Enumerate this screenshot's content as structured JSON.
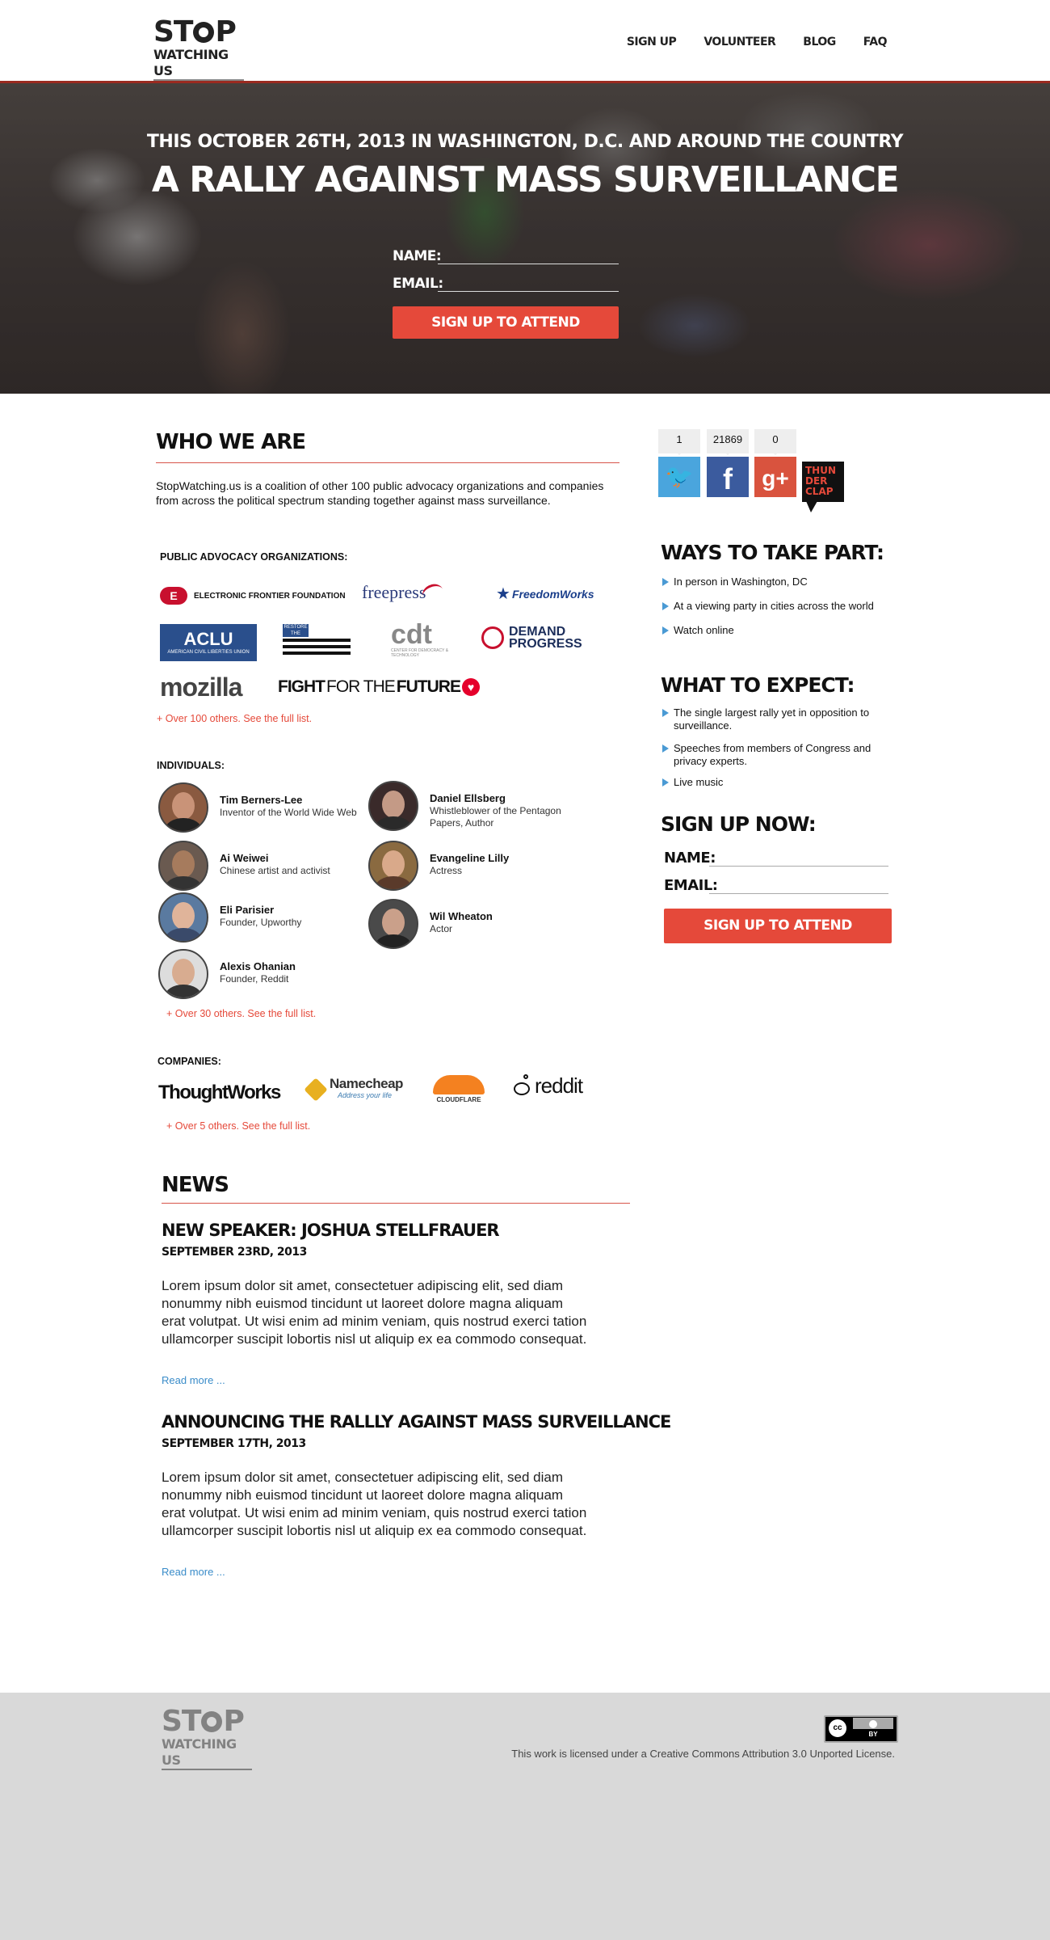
{
  "header": {
    "logo_line1_a": "ST",
    "logo_line1_b": "P",
    "logo_line2": "WATCHING US",
    "nav": [
      "SIGN UP",
      "VOLUNTEER",
      "BLOG",
      "FAQ"
    ]
  },
  "hero": {
    "subtitle": "THIS OCTOBER 26TH, 2013 IN WASHINGTON, D.C. AND AROUND THE COUNTRY",
    "title": "A RALLY AGAINST MASS SURVEILLANCE",
    "name_label": "NAME:",
    "email_label": "EMAIL:",
    "button": "SIGN UP TO ATTEND"
  },
  "who": {
    "title": "WHO WE ARE",
    "description": "StopWatching.us is a coalition of other 100 public advocacy organizations and companies from across the political spectrum standing  together against mass surveillance.",
    "orgs_heading": "PUBLIC ADVOCACY ORGANIZATIONS:",
    "orgs": {
      "eff": "ELECTRONIC FRONTIER FOUNDATION",
      "freepress": "freepress",
      "freedomworks": "FreedomWorks",
      "aclu": "ACLU",
      "aclu_sub": "AMERICAN CIVIL LIBERTIES UNION",
      "restore": "RESTORE THE FOURTH",
      "cdt": "cdt",
      "cdt_sub": "CENTER FOR DEMOCRACY & TECHNOLOGY",
      "demand1": "DEMAND",
      "demand2": "PROGRESS",
      "mozilla": "mozilla",
      "fftf_a": "FIGHT",
      "fftf_b": "FOR THE",
      "fftf_c": "FUTURE"
    },
    "orgs_more": "+ Over 100 others. See the full list.",
    "individuals_heading": "INDIVIDUALS:",
    "individuals": [
      {
        "name": "Tim Berners-Lee",
        "role": "Inventor of the World Wide Web"
      },
      {
        "name": "Daniel Ellsberg",
        "role": "Whistleblower of the Pentagon Papers, Author"
      },
      {
        "name": "Ai Weiwei",
        "role": "Chinese artist and activist"
      },
      {
        "name": "Evangeline Lilly",
        "role": "Actress"
      },
      {
        "name": "Eli Parisier",
        "role": "Founder, Upworthy"
      },
      {
        "name": "Wil Wheaton",
        "role": "Actor"
      },
      {
        "name": "Alexis Ohanian",
        "role": "Founder, Reddit"
      }
    ],
    "individuals_more": "+ Over 30 others. See the full list.",
    "companies_heading": "COMPANIES:",
    "companies": {
      "thoughtworks": "ThoughtWorks",
      "namecheap": "Namecheap",
      "namecheap_tag": "Address your life",
      "cloudflare": "CLOUDFLARE",
      "reddit": "reddit"
    },
    "companies_more": "+ Over 5 others. See the full list."
  },
  "news": {
    "title": "NEWS",
    "items": [
      {
        "title": "NEW SPEAKER: JOSHUA STELLFRAUER",
        "date": "SEPTEMBER 23RD, 2013",
        "body": "Lorem ipsum dolor sit amet, consectetuer adipiscing elit, sed diam nonummy nibh euismod tincidunt ut laoreet dolore magna aliquam erat volutpat. Ut wisi enim ad minim veniam, quis nostrud exerci tation ullamcorper suscipit lobortis nisl ut aliquip ex ea commodo consequat.",
        "more": "Read more ..."
      },
      {
        "title": "ANNOUNCING THE RALLLY AGAINST MASS SURVEILLANCE",
        "date": "SEPTEMBER 17TH, 2013",
        "body": "Lorem ipsum dolor sit amet, consectetuer adipiscing elit, sed diam nonummy nibh euismod tincidunt ut laoreet dolore magna aliquam erat volutpat. Ut wisi enim ad minim veniam, quis nostrud exerci tation ullamcorper suscipit lobortis nisl ut aliquip ex ea commodo consequat.",
        "more": "Read more ..."
      }
    ]
  },
  "sidebar": {
    "shares": {
      "twitter": "1",
      "facebook": "21869",
      "googleplus": "0"
    },
    "thunderclap": [
      "THUN",
      "DER",
      "CLAP"
    ],
    "ways_title": "WAYS TO TAKE PART:",
    "ways": [
      "In person in Washington, DC",
      "At a viewing party in cities across the world",
      "Watch online"
    ],
    "expect_title": "WHAT TO EXPECT:",
    "expect": [
      "The single largest rally yet in opposition to surveillance.",
      "Speeches from members of Congress and privacy experts.",
      "Live music"
    ],
    "signup_title": "SIGN UP NOW:",
    "name_label": "NAME:",
    "email_label": "EMAIL:",
    "button": "SIGN UP TO ATTEND"
  },
  "footer": {
    "logo_line1_a": "ST",
    "logo_line1_b": "P",
    "logo_line2": "WATCHING US",
    "cc_label": "cc",
    "cc_by": "BY",
    "license": "This work is licensed under a Creative Commons Attribution 3.0 Unported License."
  },
  "colors": {
    "accent": "#e5493a",
    "link": "#3a8cc9",
    "twitter": "#4aa5dd",
    "facebook": "#3b5b9e",
    "googleplus": "#d9533e"
  }
}
